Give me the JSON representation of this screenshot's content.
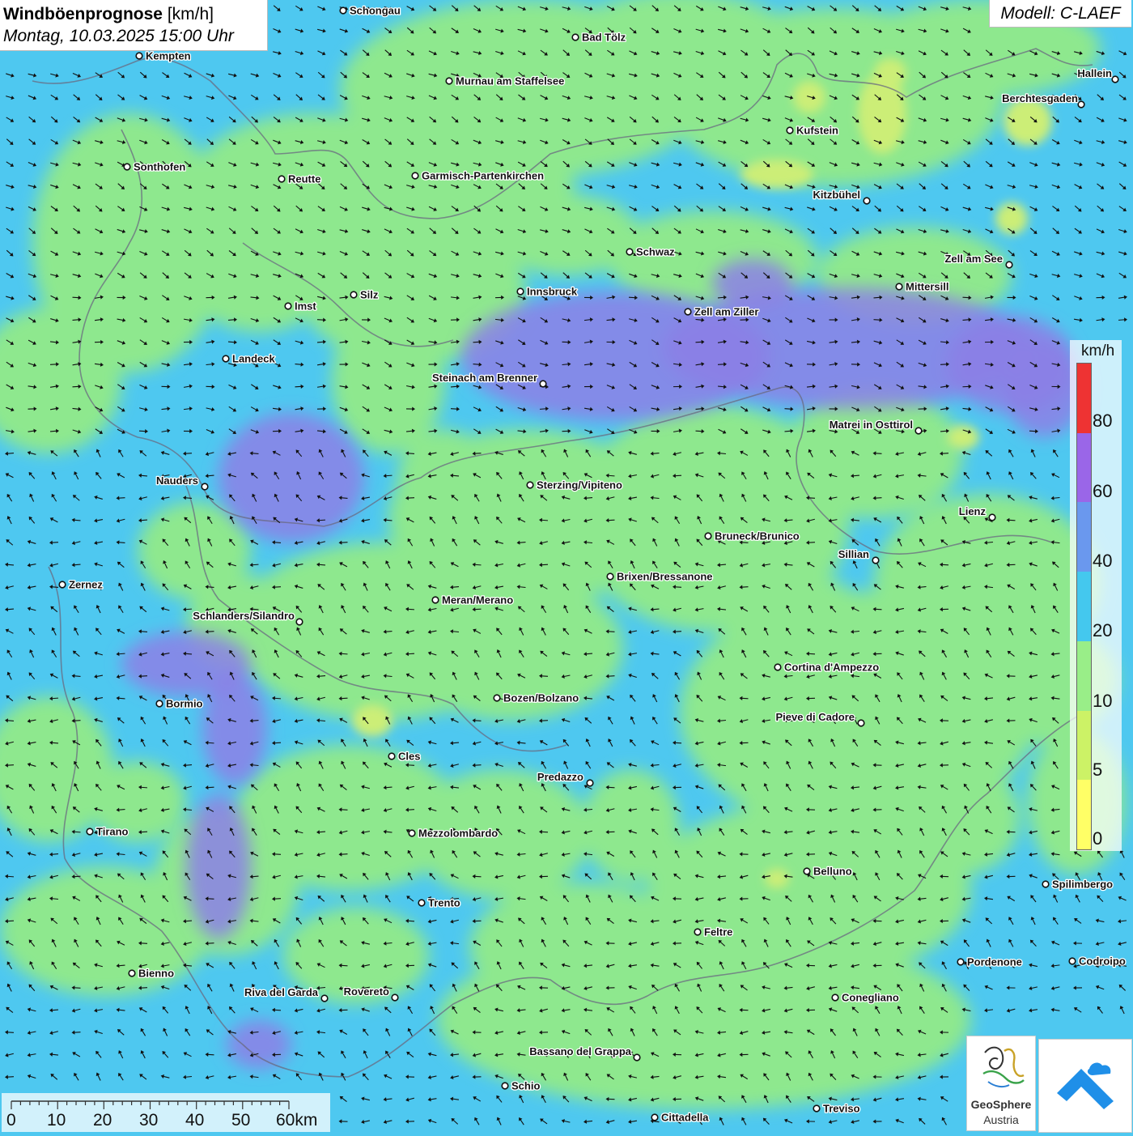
{
  "header": {
    "title_bold": "Windböenprognose",
    "title_unit": "[km/h]",
    "datetime": "Montag, 10.03.2025 15:00 Uhr",
    "model": "Modell: C-LAEF"
  },
  "legend": {
    "unit": "km/h",
    "ticks": [
      "80",
      "60",
      "40",
      "20",
      "10",
      "5",
      "0"
    ],
    "colors": [
      "#ffff66",
      "#ccf266",
      "#99ee88",
      "#44c8ee",
      "#6a98ee",
      "#9a66e8",
      "#ee3333"
    ]
  },
  "scale_bar": {
    "labels": [
      "0",
      "10",
      "20",
      "30",
      "40",
      "50",
      "60km"
    ]
  },
  "logos": {
    "geosphere_name": "GeoSphere",
    "geosphere_sub": "Austria"
  },
  "map_colors": {
    "sea_blue": "#4ec8f0",
    "green": "#8ee88e",
    "purple": "#8c80e6",
    "yellow_green": "#ccee77",
    "arrow": "#111111"
  },
  "cities": [
    {
      "name": "Schongau"
    },
    {
      "name": "Bad Tölz"
    },
    {
      "name": "Kempten"
    },
    {
      "name": "Murnau am Staffelsee"
    },
    {
      "name": "Hallein"
    },
    {
      "name": "Berchtesgaden"
    },
    {
      "name": "Kufstein"
    },
    {
      "name": "Sonthofen"
    },
    {
      "name": "Reutte"
    },
    {
      "name": "Garmisch-Partenkirchen"
    },
    {
      "name": "Kitzbühel"
    },
    {
      "name": "Schwaz"
    },
    {
      "name": "Zell am See"
    },
    {
      "name": "Mittersill"
    },
    {
      "name": "Innsbruck"
    },
    {
      "name": "Silz"
    },
    {
      "name": "Imst"
    },
    {
      "name": "Zell am Ziller"
    },
    {
      "name": "Landeck"
    },
    {
      "name": "Steinach am Brenner"
    },
    {
      "name": "Matrei in Osttirol"
    },
    {
      "name": "Nauders"
    },
    {
      "name": "Sterzing/Vipiteno"
    },
    {
      "name": "Lienz"
    },
    {
      "name": "Bruneck/Brunico"
    },
    {
      "name": "Sillian"
    },
    {
      "name": "Brixen/Bressanone"
    },
    {
      "name": "Zernez"
    },
    {
      "name": "Meran/Merano"
    },
    {
      "name": "Schlanders/Silandro"
    },
    {
      "name": "Cortina d'Ampezzo"
    },
    {
      "name": "Bozen/Bolzano"
    },
    {
      "name": "Bormio"
    },
    {
      "name": "Pieve di Cadore"
    },
    {
      "name": "Cles"
    },
    {
      "name": "Predazzo"
    },
    {
      "name": "Tirano"
    },
    {
      "name": "Mezzolombardo"
    },
    {
      "name": "Belluno"
    },
    {
      "name": "Spilimbergo"
    },
    {
      "name": "Trento"
    },
    {
      "name": "Feltre"
    },
    {
      "name": "Pordenone"
    },
    {
      "name": "Codroipo"
    },
    {
      "name": "Bienno"
    },
    {
      "name": "Riva del Garda"
    },
    {
      "name": "Rovereto"
    },
    {
      "name": "Conegliano"
    },
    {
      "name": "Bassano del Grappa"
    },
    {
      "name": "Schio"
    },
    {
      "name": "Treviso"
    },
    {
      "name": "Cittadella"
    }
  ]
}
